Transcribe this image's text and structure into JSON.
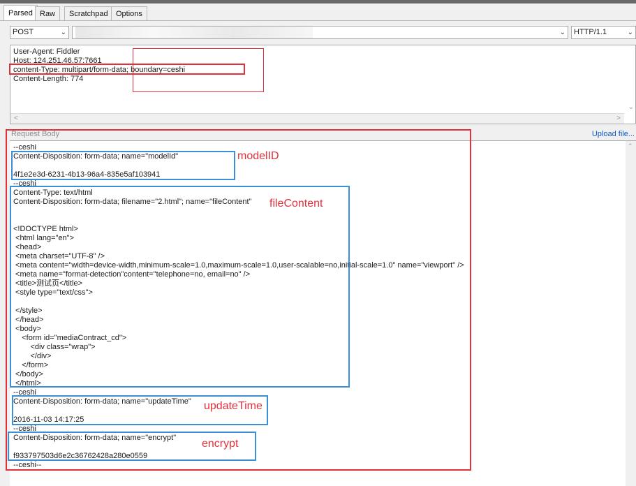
{
  "tabs": [
    "Parsed",
    "Raw",
    "Scratchpad",
    "Options"
  ],
  "request": {
    "method": "POST",
    "protocol": "HTTP/1.1"
  },
  "headers": [
    "User-Agent: Fiddler",
    "Host: 124.251.46.57:7661",
    "content-Type: multipart/form-data; boundary=ceshi",
    "Content-Length: 774"
  ],
  "body_panel": {
    "label": "Request Body",
    "upload_link": "Upload file..."
  },
  "body_lines": [
    "--ceshi",
    "Content-Disposition: form-data; name=\"modelId\"",
    "",
    "4f1e2e3d-6231-4b13-96a4-835e5af103941",
    "--ceshi",
    "Content-Type: text/html",
    "Content-Disposition: form-data; filename=\"2.html\"; name=\"fileContent\"",
    "",
    "",
    "<!DOCTYPE html>",
    " <html lang=\"en\">",
    " <head>",
    " <meta charset=\"UTF-8\" />",
    " <meta content=\"width=device-width,minimum-scale=1.0,maximum-scale=1.0,user-scalable=no,initial-scale=1.0\" name=\"viewport\" />",
    " <meta name=\"format-detection\"content=\"telephone=no, email=no\" />",
    " <title>测试页</title>",
    " <style type=\"text/css\">",
    "",
    " </style>",
    " </head>",
    " <body>",
    "    <form id=\"mediaContract_cd\">",
    "        <div class=\"wrap\">",
    "        </div>",
    "    </form>",
    " </body>",
    " </html>",
    "--ceshi",
    "Content-Disposition: form-data; name=\"updateTime\"",
    "",
    "2016-11-03 14:17:25",
    "--ceshi",
    "Content-Disposition: form-data; name=\"encrypt\"",
    "",
    "f933797503d6e2c36762428a280e0559",
    "--ceshi--"
  ],
  "annotations": {
    "modelID": "modelID",
    "fileContent": "fileContent",
    "updateTime": "updateTime",
    "encrypt": "encrypt"
  }
}
